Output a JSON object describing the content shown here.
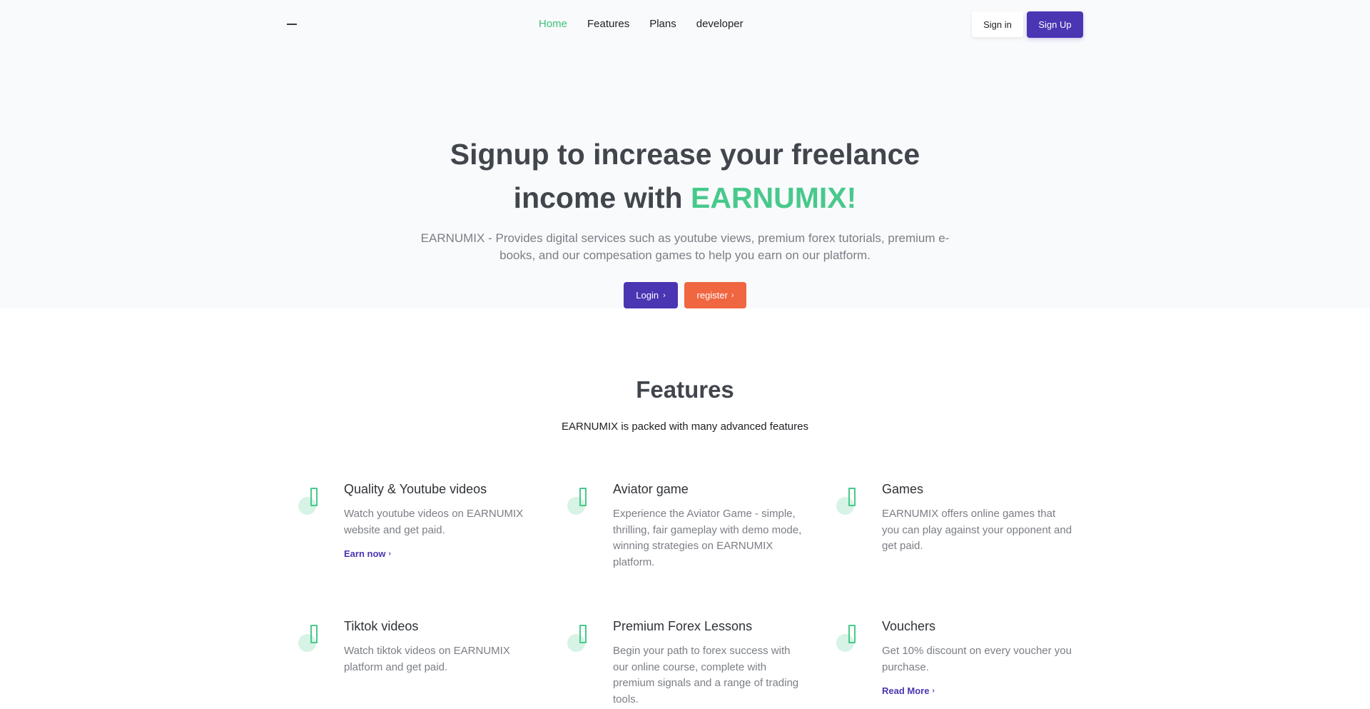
{
  "nav": {
    "links": [
      {
        "label": "Home",
        "active": true
      },
      {
        "label": "Features",
        "active": false
      },
      {
        "label": "Plans",
        "active": false
      },
      {
        "label": "developer",
        "active": false
      }
    ],
    "signin_label": "Sign in",
    "signup_label": "Sign Up"
  },
  "hero": {
    "title_line1": "Signup to increase your freelance",
    "title_line2_prefix": "income with ",
    "title_brand": "EARNUMIX!",
    "description": "EARNUMIX - Provides digital services such as youtube views, premium forex tutorials, premium e-books, and our compesation games to help you earn on our platform.",
    "login_label": "Login",
    "register_label": "register"
  },
  "features": {
    "title": "Features",
    "subtitle": "EARNUMIX is packed with many advanced features",
    "items": [
      {
        "title": "Quality & Youtube videos",
        "description": "Watch youtube videos on EARNUMIX website and get paid.",
        "link": "Earn now"
      },
      {
        "title": "Aviator game",
        "description": "Experience the Aviator Game - simple, thrilling, fair gameplay with demo mode, winning strategies on EARNUMIX platform.",
        "link": ""
      },
      {
        "title": "Games",
        "description": "EARNUMIX offers online games that you can play against your opponent and get paid.",
        "link": ""
      },
      {
        "title": "Tiktok videos",
        "description": "Watch tiktok videos on EARNUMIX platform and get paid.",
        "link": ""
      },
      {
        "title": "Premium Forex Lessons",
        "description": "Begin your path to forex success with our online course, complete with premium signals and a range of trading tools.",
        "link": ""
      },
      {
        "title": "Vouchers",
        "description": "Get 10% discount on every voucher you purchase.",
        "link": "Read More"
      }
    ]
  },
  "colors": {
    "accent_green": "#48c98c",
    "primary_purple": "#4a35b3",
    "register_orange": "#ef6641"
  },
  "icons": {
    "arrow": "arrow-right-icon",
    "feature": "feature-icon"
  }
}
